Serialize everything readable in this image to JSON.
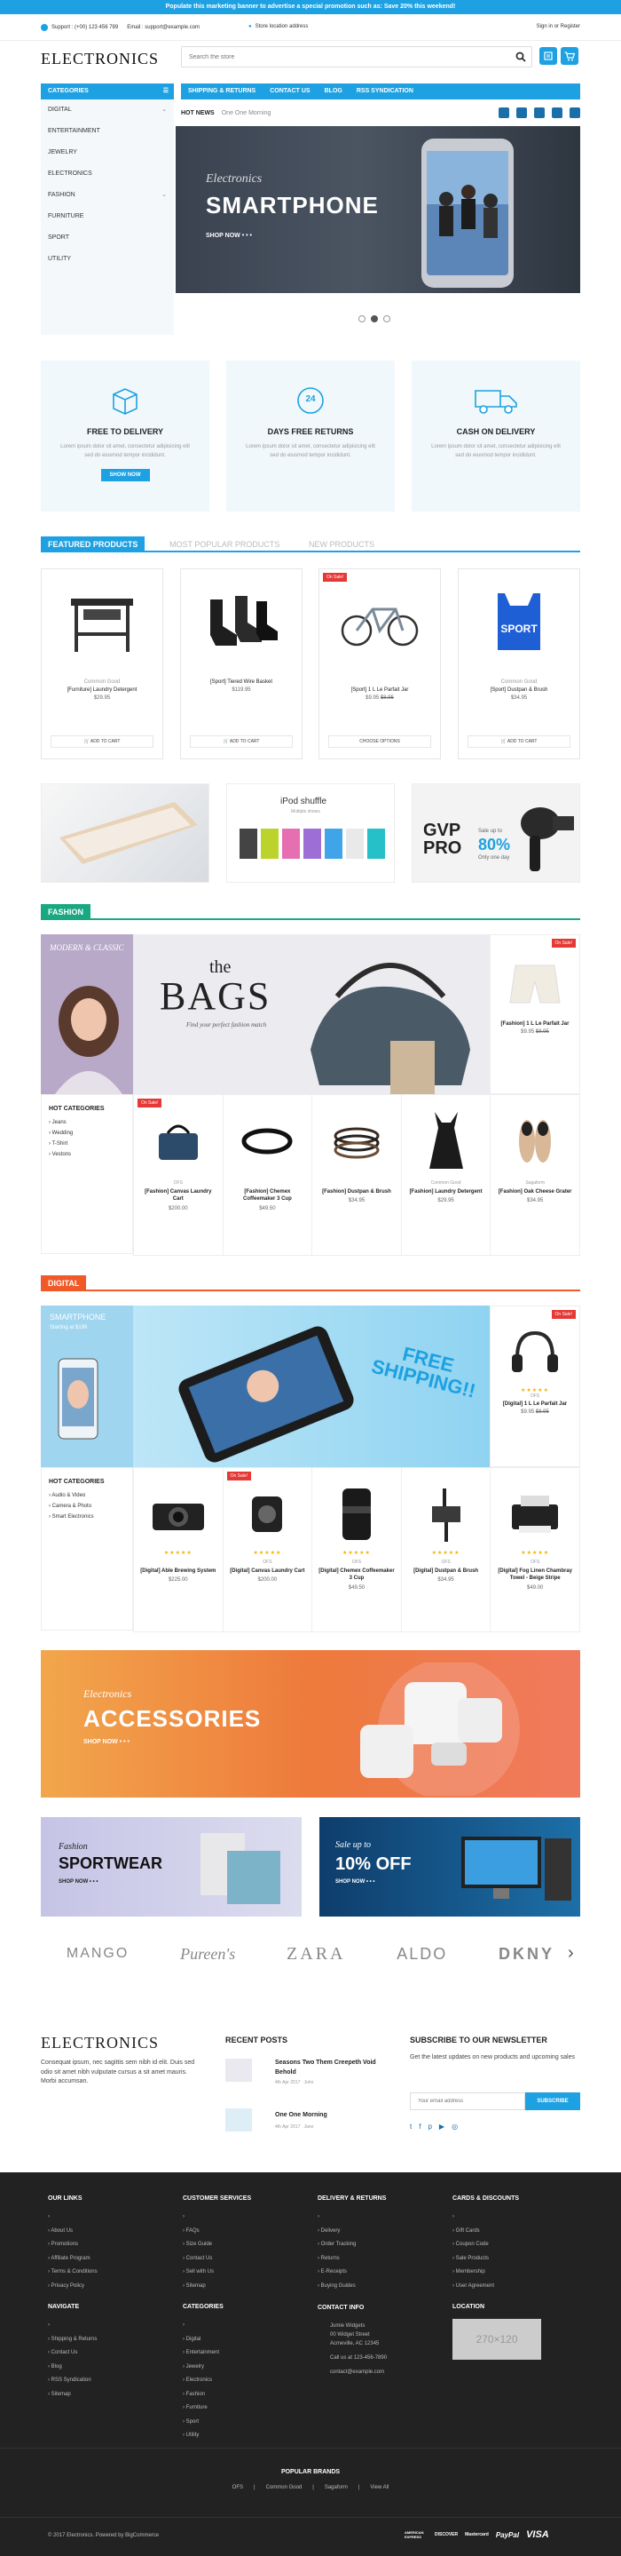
{
  "top_banner": "Populate this marketing banner to advertise a special promotion such as: Save 20% this weekend!",
  "topbar": {
    "support": "Support : (+00) 123 456 789",
    "email": "Email : support@example.com",
    "store": "Store location address",
    "account": "Sign in  or  Register"
  },
  "header": {
    "logo": "ELECTRONICS",
    "search_placeholder": "Search the store",
    "cart_count": "0"
  },
  "categories": {
    "title": "CATEGORIES",
    "items": [
      "DIGITAL",
      "ENTERTAINMENT",
      "JEWELRY",
      "ELECTRONICS",
      "FASHION",
      "FURNITURE",
      "SPORT",
      "UTILITY"
    ]
  },
  "nav": [
    "SHIPPING & RETURNS",
    "CONTACT US",
    "BLOG",
    "RSS SYNDICATION"
  ],
  "news": {
    "label": "HOT NEWS",
    "text": "One One Morning"
  },
  "hero": {
    "kicker": "Electronics",
    "title": "SMARTPHONE",
    "cta": "SHOP NOW"
  },
  "features": [
    {
      "title": "FREE TO DELIVERY",
      "text": "Lorem ipsum dolor sit amet, consectetur adipisicing elit sed do eiusmod tempor incididunt.",
      "button": "SHOW NOW"
    },
    {
      "title": "DAYS FREE RETURNS",
      "text": "Lorem ipsum dolor sit amet, consectetur adipisicing elit sed do eiusmod tempor incididunt.",
      "badge": "24"
    },
    {
      "title": "CASH ON DELIVERY",
      "text": "Lorem ipsum dolor sit amet, consectetur adipisicing elit sed do eiusmod tempor incididunt."
    }
  ],
  "tabs": [
    "FEATURED PRODUCTS",
    "MOST POPULAR PRODUCTS",
    "NEW PRODUCTS"
  ],
  "featured": [
    {
      "brand": "Common Good",
      "name": "[Furniture] Laundry Detergent",
      "price": "$29.95",
      "button": "ADD TO CART",
      "sale": ""
    },
    {
      "brand": "",
      "name": "[Sport] Tiered Wire Basket",
      "price": "$119.95",
      "button": "ADD TO CART",
      "sale": ""
    },
    {
      "brand": "",
      "name": "[Sport] 1 L Le Parfait Jar",
      "price": "$9.95",
      "old_price": "$8.95",
      "button": "CHOOSE OPTIONS",
      "sale": "On Sale!"
    },
    {
      "brand": "Common Good",
      "name": "[Sport] Dustpan & Brush",
      "price": "$34.95",
      "button": "ADD TO CART",
      "sale": ""
    }
  ],
  "promos": {
    "ipod_title": "iPod shuffle",
    "ipod_sub": "Multiple shows",
    "gvp_big": "GVP PRO",
    "gvp_save": "Sale up to",
    "gvp_pct": "80%",
    "gvp_day": "Only one day"
  },
  "fashion": {
    "title": "FASHION",
    "side_title": "MODERN & CLASSIC",
    "banner_the": "the",
    "banner_big": "BAGS",
    "banner_sub": "Find your perfect fashion match",
    "hot_title": "HOT CATEGORIES",
    "hot_items": [
      "Jeans",
      "Wedding",
      "T-Shirt",
      "Vestons"
    ],
    "feature": {
      "name": "[Fashion] 1 L Le Parfait Jar",
      "price": "$9.95",
      "old_price": "$8.95",
      "sale": "On Sale!"
    },
    "products": [
      {
        "brand": "OFS",
        "name": "[Fashion] Canvas Laundry Cart",
        "price": "$200.00",
        "sale": "On Sale!"
      },
      {
        "brand": "",
        "name": "[Fashion] Chemex Coffeemaker 3 Cup",
        "price": "$49.50",
        "sale": ""
      },
      {
        "brand": "",
        "name": "[Fashion] Dustpan & Brush",
        "price": "$34.95",
        "sale": ""
      },
      {
        "brand": "Common Good",
        "name": "[Fashion] Laundry Detergent",
        "price": "$29.95",
        "sale": ""
      },
      {
        "brand": "Sagaform",
        "name": "[Fashion] Oak Cheese Grater",
        "price": "$34.95",
        "sale": ""
      }
    ]
  },
  "digital": {
    "title": "DIGITAL",
    "side_title": "SMARTPHONE",
    "side_sub": "Starting at $199",
    "banner_text": "FREE SHIPPING!!",
    "hot_title": "HOT CATEGORIES",
    "hot_items": [
      "Audio & Video",
      "Camera & Photo",
      "Smart Electronics"
    ],
    "feature": {
      "brand": "OFS",
      "name": "[Digital] 1 L Le Parfait Jar",
      "price": "$9.95",
      "old_price": "$8.95",
      "sale": "On Sale!"
    },
    "products": [
      {
        "brand": "",
        "name": "[Digital] Able Brewing System",
        "price": "$225.00",
        "sale": ""
      },
      {
        "brand": "OFS",
        "name": "[Digital] Canvas Laundry Cart",
        "price": "$200.00",
        "sale": "On Sale!"
      },
      {
        "brand": "OFS",
        "name": "[Digital] Chemex Coffeemaker 3 Cup",
        "price": "$49.50",
        "sale": ""
      },
      {
        "brand": "OFS",
        "name": "[Digital] Dustpan & Brush",
        "price": "$34.95",
        "sale": ""
      },
      {
        "brand": "OFS",
        "name": "[Digital] Fog Linen Chambray Towel - Beige Stripe",
        "price": "$49.00",
        "sale": ""
      }
    ]
  },
  "accessories": {
    "kicker": "Electronics",
    "title": "ACCESSORIES",
    "cta": "SHOP NOW"
  },
  "sportwear": {
    "kicker": "Fashion",
    "title": "SPORTWEAR",
    "cta": "SHOP NOW"
  },
  "sale10": {
    "kicker": "Sale up to",
    "title": "10% OFF",
    "cta": "SHOP NOW"
  },
  "brands": [
    "MANGO",
    "Pureen's",
    "ZARA",
    "ALDO",
    "DKNY"
  ],
  "about": {
    "logo": "ELECTRONICS",
    "text": "Consequat ipsum, nec sagittis sem nibh id elit. Duis sed odio sit amet nibh vulputate cursus a sit amet mauris. Morbi accumsan."
  },
  "recent_posts": {
    "title": "RECENT POSTS",
    "posts": [
      {
        "title": "Seasons Two Them Creepeth Void Behold",
        "date": "4th Apr 2017",
        "author": "John"
      },
      {
        "title": "One One Morning",
        "date": "4th Apr 2017",
        "author": "Jane"
      }
    ]
  },
  "newsletter": {
    "title": "SUBSCRIBE TO OUR NEWSLETTER",
    "text": "Get the latest updates on new products and upcoming sales",
    "placeholder": "Your email address",
    "button": "SUBSCRIBE"
  },
  "footer": {
    "our_links": {
      "title": "OUR LINKS",
      "items": [
        "About Us",
        "Promotions",
        "Affiliate Program",
        "Terms & Conditions",
        "Privacy Policy"
      ]
    },
    "customer_services": {
      "title": "CUSTOMER SERVICES",
      "items": [
        "FAQs",
        "Size Guide",
        "Contact Us",
        "Sell with Us",
        "Sitemap"
      ]
    },
    "delivery": {
      "title": "DELIVERY & RETURNS",
      "items": [
        "Delivery",
        "Order Tracking",
        "Returns",
        "E-Receipts",
        "Buying Guides"
      ]
    },
    "cards": {
      "title": "CARDS & DISCOUNTS",
      "items": [
        "Gift Cards",
        "Coupon Code",
        "Sale Products",
        "Membership",
        "User Agreement"
      ]
    },
    "navigate": {
      "title": "NAVIGATE",
      "items": [
        "Shipping & Returns",
        "Contact Us",
        "Blog",
        "RSS Syndication",
        "Sitemap"
      ]
    },
    "categories": {
      "title": "CATEGORIES",
      "items": [
        "Digital",
        "Entertainment",
        "Jewelry",
        "Electronics",
        "Fashion",
        "Furniture",
        "Sport",
        "Utility"
      ]
    },
    "contact": {
      "title": "CONTACT INFO",
      "name": "Jumie Widgets",
      "address1": "00 Widget Street",
      "address2": "Acmeville, AC 12345",
      "phone": "Call us at 123-456-7890",
      "email": "contact@example.com"
    },
    "location": {
      "title": "LOCATION",
      "map": "270×120"
    },
    "popular_brands": {
      "title": "POPULAR BRANDS",
      "items": [
        "OFS",
        "Common Good",
        "Sagaform",
        "View All"
      ]
    },
    "copyright": "© 2017 Electronics. Powered by BigCommerce",
    "payments": [
      "AMERICAN EXPRESS",
      "DISCOVER",
      "Mastercard",
      "PayPal",
      "VISA"
    ]
  }
}
